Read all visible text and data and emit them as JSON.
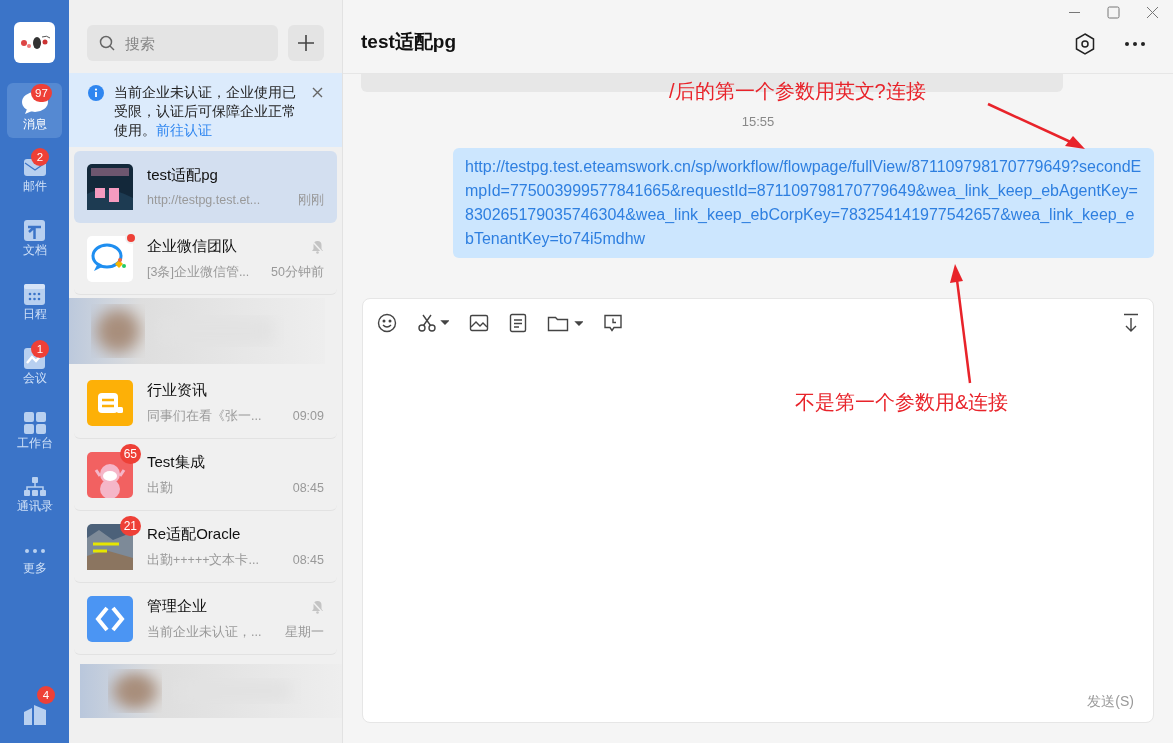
{
  "nav": [
    {
      "label": "消息",
      "badge": "97",
      "selected": true
    },
    {
      "label": "邮件",
      "badge": "2",
      "selected": false
    },
    {
      "label": "文档",
      "selected": false
    },
    {
      "label": "日程",
      "selected": false
    },
    {
      "label": "会议",
      "badge": "1",
      "selected": false
    },
    {
      "label": "工作台",
      "selected": false
    },
    {
      "label": "通讯录",
      "selected": false
    },
    {
      "label": "更多",
      "selected": false
    }
  ],
  "nav_bottom": {
    "badge": "4"
  },
  "search": {
    "placeholder": "搜索"
  },
  "notice": {
    "text": "当前企业未认证，企业使用已受限，认证后可保障企业正常使用。",
    "link": "前往认证"
  },
  "conversations": [
    {
      "kind": "chat",
      "title": "test适配pg",
      "preview": "http://testpg.test.et...",
      "time": "刚刚",
      "selected": true,
      "muted": false,
      "unread_dot": false
    },
    {
      "kind": "chat",
      "title": "企业微信团队",
      "preview": "[3条]企业微信管...",
      "time": "50分钟前",
      "selected": false,
      "muted": true,
      "unread_dot": true
    },
    {
      "kind": "blurred"
    },
    {
      "kind": "chat",
      "title": "行业资讯",
      "preview": "同事们在看《张一...",
      "time": "09:09",
      "selected": false,
      "muted": false,
      "unread_dot": false
    },
    {
      "kind": "chat",
      "title": "Test集成",
      "preview": "出勤",
      "time": "08:45",
      "badge": "65",
      "selected": false,
      "muted": false,
      "unread_dot": false
    },
    {
      "kind": "chat",
      "title": "Re适配Oracle",
      "preview": "出勤+++++文本卡...",
      "time": "08:45",
      "badge": "21",
      "selected": false,
      "muted": false,
      "unread_dot": false
    },
    {
      "kind": "chat",
      "title": "管理企业",
      "preview": "当前企业未认证，...",
      "time": "星期一",
      "selected": false,
      "muted": true,
      "unread_dot": false
    },
    {
      "kind": "blurred"
    }
  ],
  "chat": {
    "title": "test适配pg",
    "time_divider": "15:55",
    "message": "http://testpg.test.eteamswork.cn/sp/workflow/flowpage/fullView/871109798170779649?secondEmpId=775003999577841665&requestId=871109798170779649&wea_link_keep_ebAgentKey=830265179035746304&wea_link_keep_ebCorpKey=783254141977542657&wea_link_keep_ebTenantKey=to74i5mdhw",
    "send": "发送(S)"
  },
  "annotations": [
    "/后的第一个参数用英文?连接",
    "不是第一个参数用&连接"
  ]
}
